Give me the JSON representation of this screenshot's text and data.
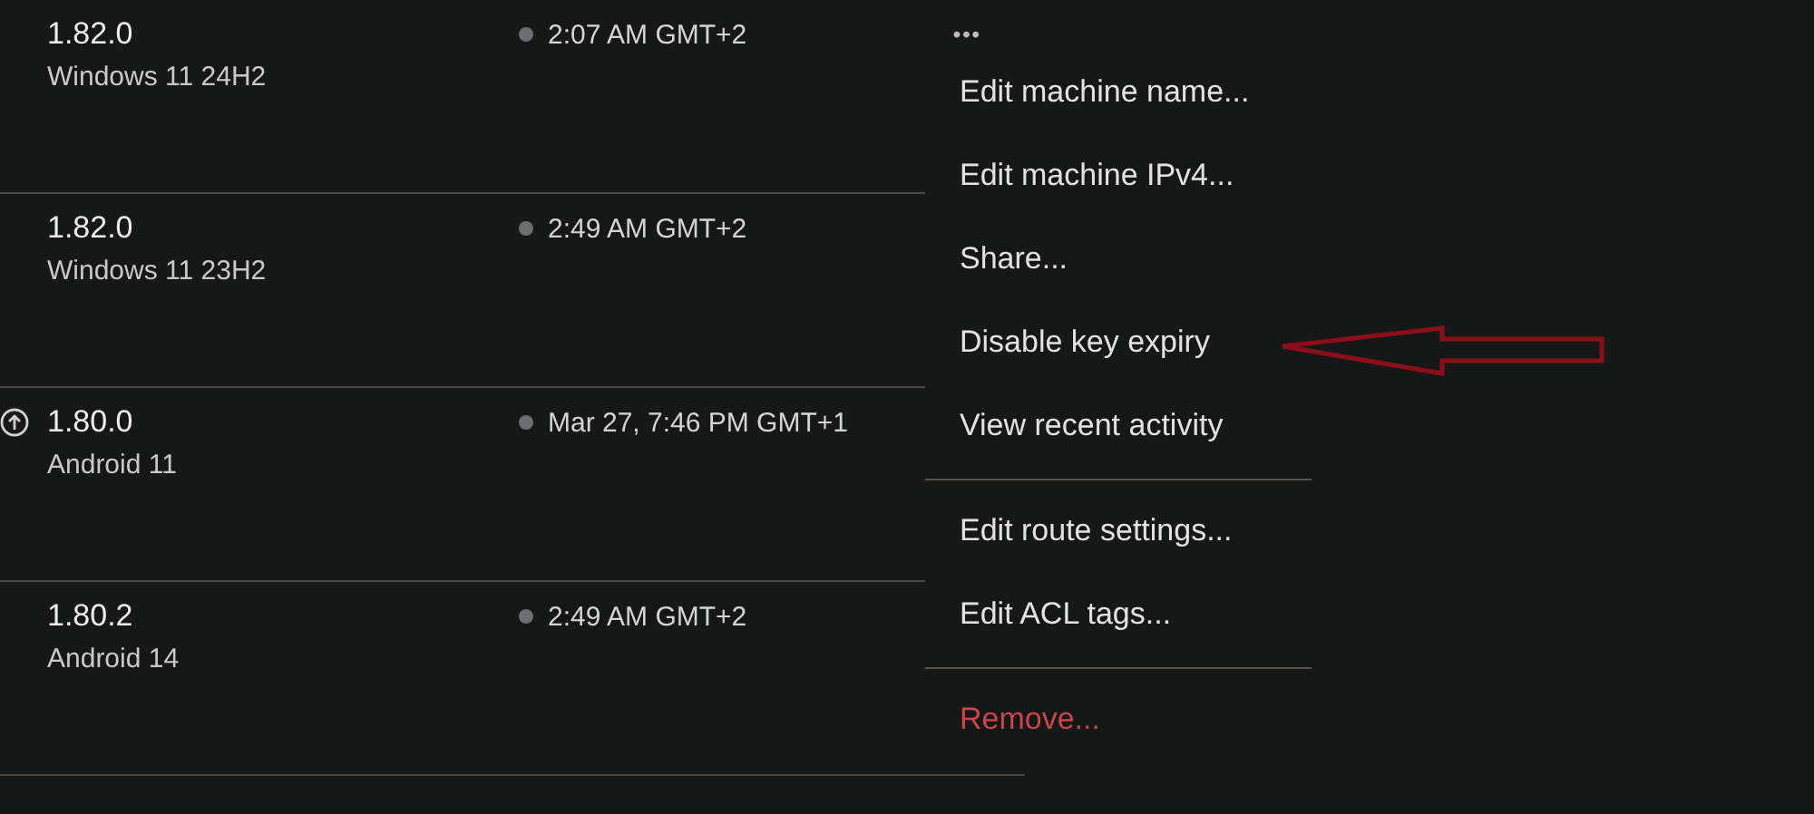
{
  "machines": [
    {
      "version": "1.82.0",
      "os": "Windows 11 24H2",
      "update_available": false,
      "online": false,
      "last_seen": "2:07 AM GMT+2"
    },
    {
      "version": "1.82.0",
      "os": "Windows 11 23H2",
      "update_available": false,
      "online": false,
      "last_seen": "2:49 AM GMT+2"
    },
    {
      "version": "1.80.0",
      "os": "Android 11",
      "update_available": true,
      "online": false,
      "last_seen": "Mar 27, 7:46 PM GMT+1"
    },
    {
      "version": "1.80.2",
      "os": "Android 14",
      "update_available": false,
      "online": false,
      "last_seen": "2:49 AM GMT+2"
    }
  ],
  "menu_button": {
    "label": "•••"
  },
  "menu": {
    "groups": [
      [
        {
          "label": "Edit machine name...",
          "danger": false
        },
        {
          "label": "Edit machine IPv4...",
          "danger": false
        },
        {
          "label": "Share...",
          "danger": false
        },
        {
          "label": "Disable key expiry",
          "danger": false
        },
        {
          "label": "View recent activity",
          "danger": false
        }
      ],
      [
        {
          "label": "Edit route settings...",
          "danger": false
        },
        {
          "label": "Edit ACL tags...",
          "danger": false
        }
      ],
      [
        {
          "label": "Remove...",
          "danger": true
        }
      ]
    ]
  }
}
